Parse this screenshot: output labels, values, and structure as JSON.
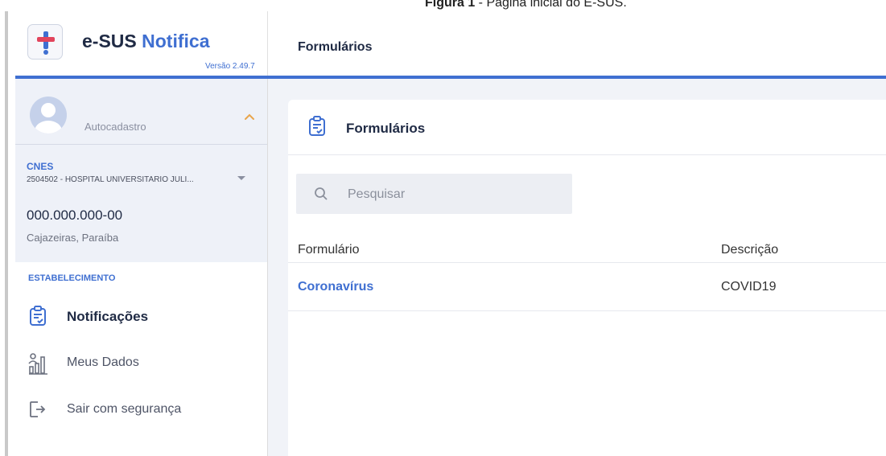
{
  "caption": {
    "prefix": "Figura 1",
    "text": " - Página inicial do E-SUS."
  },
  "app": {
    "name_part1": "e-SUS",
    "name_part2": "Notifica",
    "version": "Versão 2.49.7"
  },
  "header": {
    "title": "Formulários"
  },
  "user": {
    "name": "Autocadastro",
    "cnes_label": "CNES",
    "cnes_value": "2504502 - HOSPITAL UNIVERSITARIO JULI...",
    "document": "000.000.000-00",
    "location": "Cajazeiras, Paraíba"
  },
  "nav": {
    "section_label": "ESTABELECIMENTO",
    "items": [
      {
        "label": "Notificações",
        "icon": "clipboard-check-icon",
        "active": true
      },
      {
        "label": "Meus Dados",
        "icon": "chart-person-icon",
        "active": false
      },
      {
        "label": "Sair com segurança",
        "icon": "logout-icon",
        "active": false
      }
    ]
  },
  "main": {
    "card_title": "Formulários",
    "search": {
      "placeholder": "Pesquisar",
      "value": ""
    },
    "table": {
      "columns": [
        "Formulário",
        "Descrição"
      ],
      "rows": [
        {
          "form": "Coronavírus",
          "description": "COVID19"
        }
      ]
    }
  },
  "colors": {
    "accent": "#3f6fd1",
    "sidebar_panel": "#eef1f8",
    "main_bg": "#f1f3f8"
  }
}
